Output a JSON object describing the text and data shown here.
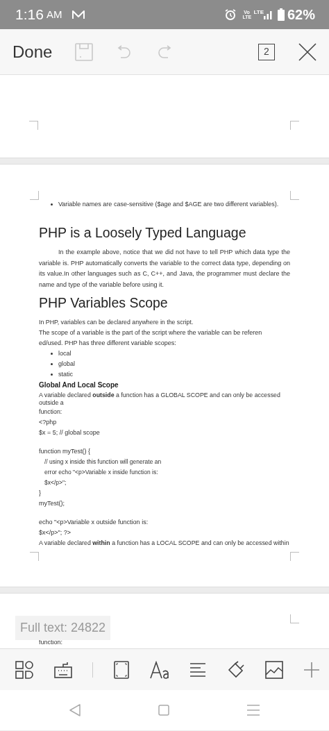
{
  "status_bar": {
    "time": "1:16",
    "ampm": "AM",
    "volte_label": "Vo LTE",
    "network_label": "LTE",
    "battery": "62%"
  },
  "toolbar": {
    "done": "Done",
    "save": {
      "disabled": true
    },
    "undo": {
      "disabled": true
    },
    "redo": {
      "disabled": true
    },
    "page_count": "2"
  },
  "document": {
    "blocks": [
      {
        "kind": "bullet",
        "text": "Variable names are case-sensitive ($age and $AGE are two different variables)."
      },
      {
        "kind": "heading",
        "text": "PHP is a Loosely Typed Language"
      },
      {
        "kind": "indented_paragraph",
        "text": "In the example above, notice that we did not have to tell PHP which data type the variable is. PHP automatically converts the variable to the correct data type, depending on its value.In other languages such as C, C++, and Java, the programmer must declare the name and type of the variable before using it."
      },
      {
        "kind": "heading",
        "text": "PHP Variables Scope"
      },
      {
        "kind": "paragraph",
        "text": "In PHP, variables can be declared anywhere in the script."
      },
      {
        "kind": "line",
        "text": "The scope of a variable is the part of the script where the variable can be referen"
      },
      {
        "kind": "line",
        "text": "ed/used. PHP has three different variable scopes:"
      },
      {
        "kind": "bullet",
        "text": "local"
      },
      {
        "kind": "bullet",
        "text": "global"
      },
      {
        "kind": "bullet",
        "text": "static"
      },
      {
        "kind": "subheading",
        "text": "Global And Local Scope"
      },
      {
        "kind": "paragraph",
        "text": "A variable declared **outside** a function has a GLOBAL SCOPE and can only be accessed outside a"
      },
      {
        "kind": "paragraph",
        "text": "function:"
      },
      {
        "kind": "line",
        "text": "<?php"
      },
      {
        "kind": "line",
        "text": "$x = 5; // global scope"
      },
      {
        "kind": "line",
        "text": "function myTest() {",
        "space_before": true
      },
      {
        "kind": "indented_line",
        "text": "// using x inside this function will generate an"
      },
      {
        "kind": "indented_line",
        "text": "error echo \"<p>Variable x inside function is:"
      },
      {
        "kind": "indented_line",
        "text": "$x</p>\";"
      },
      {
        "kind": "line",
        "text": "}"
      },
      {
        "kind": "line",
        "text": "myTest();"
      },
      {
        "kind": "line",
        "text": "echo \"<p>Variable x outside function is:",
        "space_before": true
      },
      {
        "kind": "line",
        "text": "$x</p>\"; ?>"
      },
      {
        "kind": "paragraph",
        "text": "A variable declared **within** a function has a LOCAL SCOPE and can only be accessed within"
      }
    ],
    "next_page_lines": [
      "function:"
    ],
    "full_text_badge": "Full text: 24822"
  }
}
